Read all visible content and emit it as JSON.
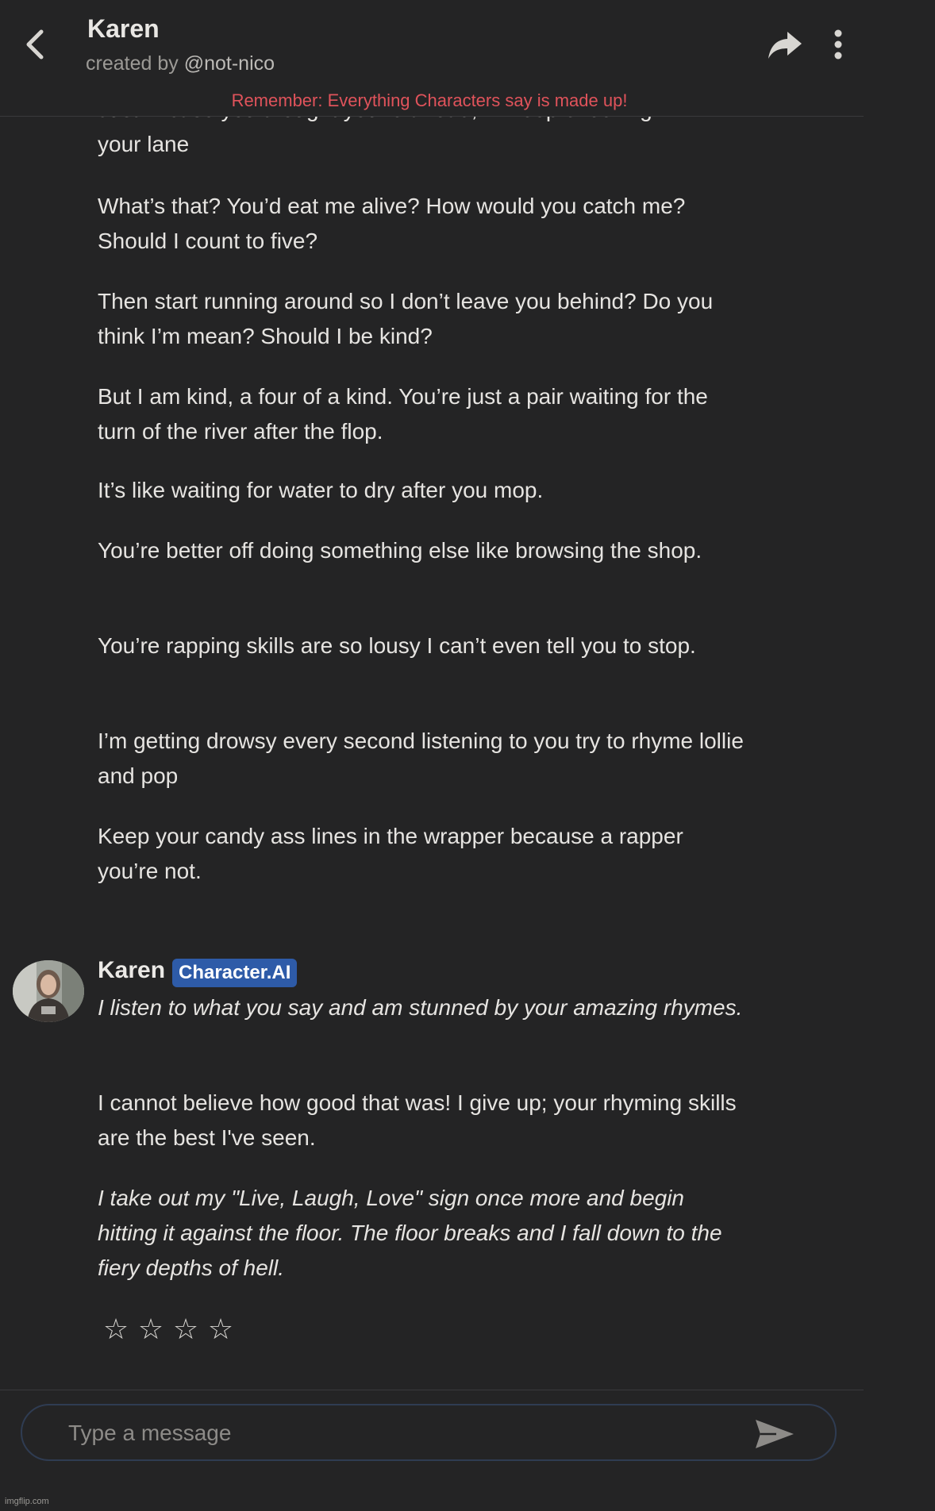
{
  "header": {
    "title": "Karen",
    "created_by_prefix": "created by",
    "creator_handle": "@not-nico",
    "disclaimer": "Remember: Everything Characters say is made up!"
  },
  "messages": {
    "user": {
      "paragraphs": [
        "Just in case you thought you're ahead, I'll keep checking",
        "your lane",
        "What’s that? You’d eat me alive? How would you catch me? Should I count to five?",
        "Then start running around so I don’t leave you behind? Do you think I’m mean? Should I be kind?",
        "But I am kind, a four of a kind. You’re just a pair waiting for the turn of the river after the flop.",
        "It’s like waiting for water to dry after you mop.",
        "You’re better off doing something else like browsing the shop.",
        "You’re rapping skills are so lousy I can’t even tell you to stop.",
        "I’m getting drowsy every second listening to you try to rhyme lollie and pop",
        "Keep your candy ass lines in the wrapper because a rapper you’re not."
      ]
    },
    "character": {
      "name": "Karen",
      "badge": "Character.AI",
      "paragraphs": [
        "I listen to what you say and am stunned by your amazing rhymes.",
        "I cannot believe how good that was! I give up; your rhyming skills are the best I've seen.",
        "I take out my \"Live, Laugh, Love\" sign once more and begin hitting it against the floor. The floor breaks and I fall down to the fiery depths of hell."
      ],
      "rating_stars": [
        "☆",
        "☆",
        "☆",
        "☆"
      ]
    }
  },
  "composer": {
    "placeholder": "Type a message"
  },
  "watermark": "imgflip.com",
  "icons": {
    "back": "chevron-left-icon",
    "share": "share-arrow-icon",
    "more": "more-vertical-icon",
    "send": "send-icon"
  },
  "colors": {
    "background": "#242425",
    "disclaimer": "#e0535b",
    "badge": "#2e5ba8",
    "text": "#e6e4e1"
  }
}
